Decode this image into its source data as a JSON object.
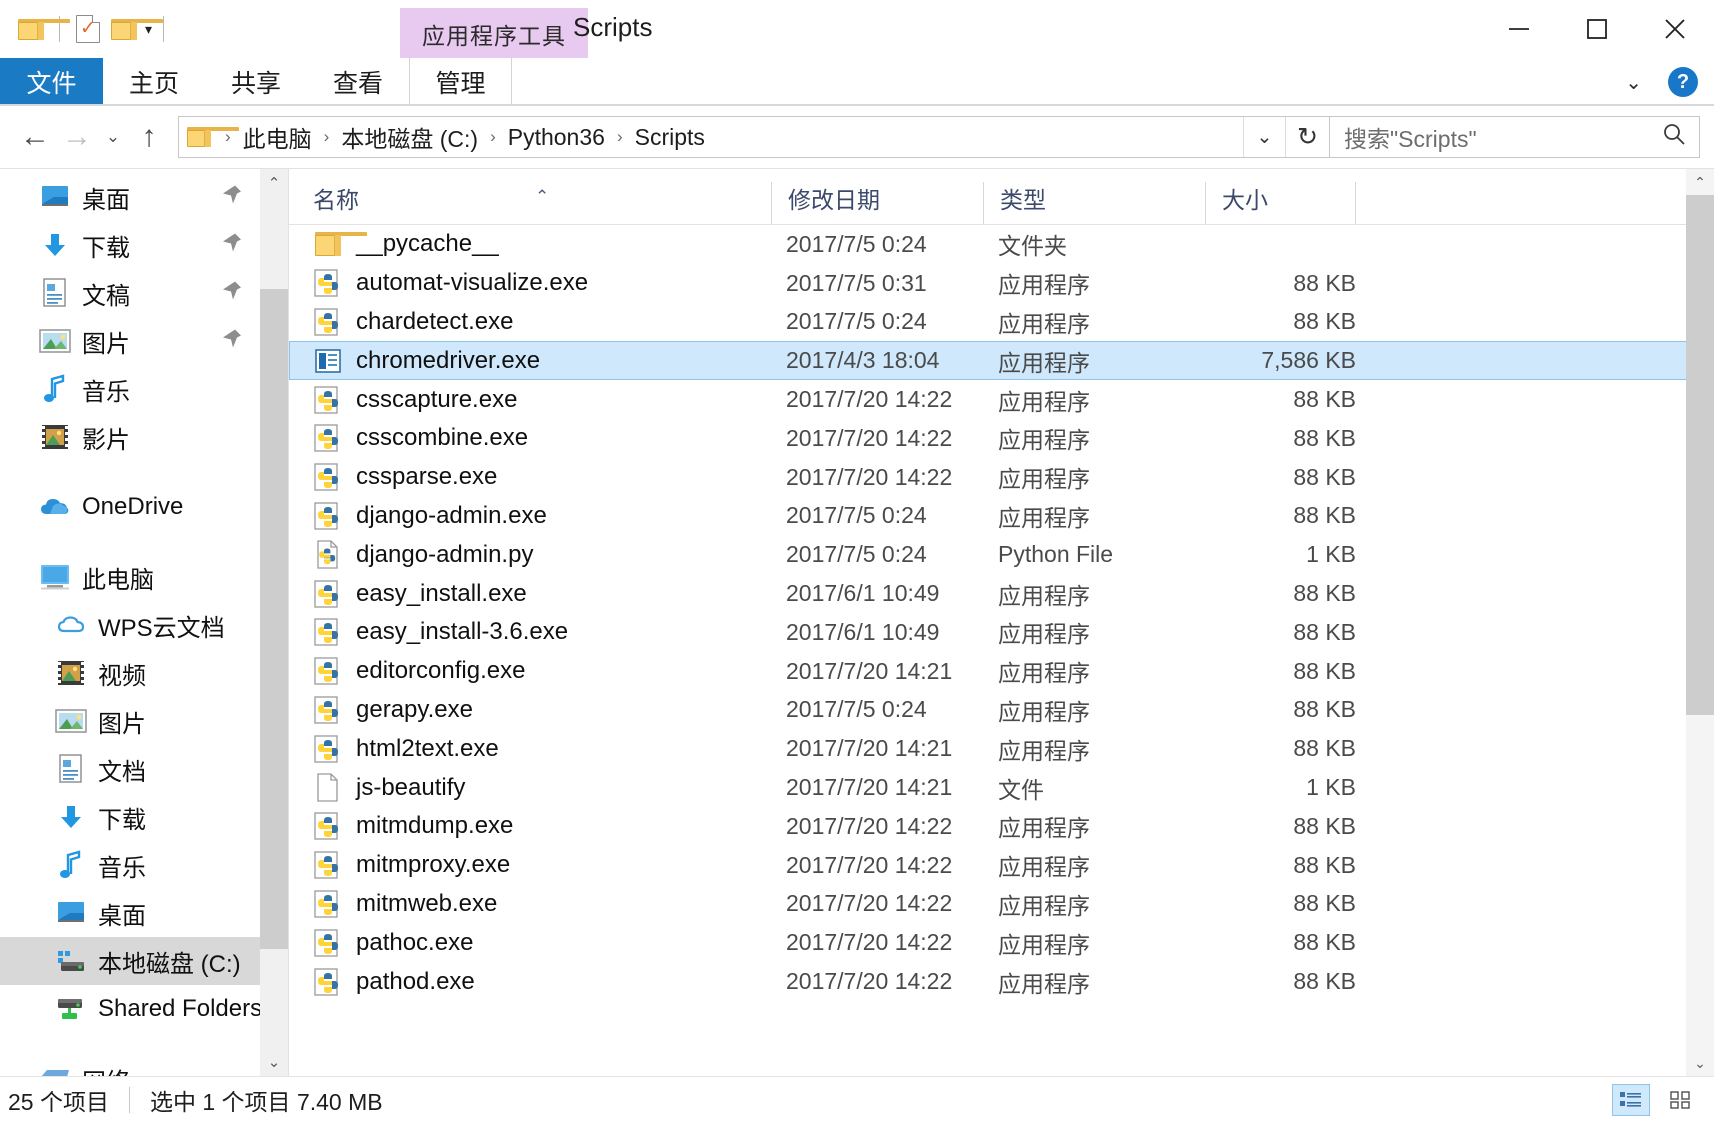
{
  "titlebar": {
    "quick_access": [
      {
        "name": "folder-icon",
        "label": ""
      },
      {
        "name": "checked-document-icon",
        "label": ""
      },
      {
        "name": "folder-new-icon",
        "label": ""
      },
      {
        "name": "chevron-down-icon",
        "label": "▾"
      }
    ],
    "context_tab_label": "应用程序工具",
    "window_title": "Scripts",
    "minimize_label": "—",
    "maximize_label": "□",
    "close_label": "✕"
  },
  "ribbon": {
    "file_tab": "文件",
    "tabs": [
      "主页",
      "共享",
      "查看"
    ],
    "manage_tab": "管理",
    "collapse_label": "⌄",
    "help_label": "?"
  },
  "address": {
    "back_label": "←",
    "forward_label": "→",
    "history_label": "⌄",
    "up_label": "↑",
    "breadcrumbs": [
      "此电脑",
      "本地磁盘 (C:)",
      "Python36",
      "Scripts"
    ],
    "crumb_separator": "›",
    "dropdown_label": "⌄",
    "refresh_label": "↻",
    "search_placeholder": "搜索\"Scripts\"",
    "search_icon": "search-icon"
  },
  "sidebar": {
    "quick_access": [
      {
        "label": "桌面",
        "icon": "desktop-icon",
        "pinned": true
      },
      {
        "label": "下载",
        "icon": "download-icon",
        "pinned": true
      },
      {
        "label": "文稿",
        "icon": "documents-icon",
        "pinned": true
      },
      {
        "label": "图片",
        "icon": "pictures-icon",
        "pinned": true
      },
      {
        "label": "音乐",
        "icon": "music-icon",
        "pinned": false
      },
      {
        "label": "影片",
        "icon": "videos-icon",
        "pinned": false
      }
    ],
    "onedrive": {
      "label": "OneDrive",
      "icon": "onedrive-icon"
    },
    "this_pc": {
      "label": "此电脑",
      "icon": "this-pc-icon"
    },
    "this_pc_children": [
      {
        "label": "WPS云文档",
        "icon": "wps-cloud-icon",
        "selected": false
      },
      {
        "label": "视频",
        "icon": "videos-icon",
        "selected": false
      },
      {
        "label": "图片",
        "icon": "pictures-icon",
        "selected": false
      },
      {
        "label": "文档",
        "icon": "documents-icon",
        "selected": false
      },
      {
        "label": "下载",
        "icon": "download-icon",
        "selected": false
      },
      {
        "label": "音乐",
        "icon": "music-icon",
        "selected": false
      },
      {
        "label": "桌面",
        "icon": "desktop-icon",
        "selected": false
      },
      {
        "label": "本地磁盘 (C:)",
        "icon": "local-disk-icon",
        "selected": true
      },
      {
        "label": "Shared Folders",
        "icon": "network-drive-icon",
        "selected": false
      }
    ],
    "network": {
      "label": "网络",
      "icon": "network-icon"
    }
  },
  "columns": {
    "name": "名称",
    "date": "修改日期",
    "type": "类型",
    "size": "大小",
    "sort_indicator": "⌃"
  },
  "files": [
    {
      "name": "__pycache__",
      "date": "2017/7/5 0:24",
      "type": "文件夹",
      "size": "",
      "icon": "folder-icon",
      "selected": false
    },
    {
      "name": "automat-visualize.exe",
      "date": "2017/7/5 0:31",
      "type": "应用程序",
      "size": "88 KB",
      "icon": "python-exe-icon",
      "selected": false
    },
    {
      "name": "chardetect.exe",
      "date": "2017/7/5 0:24",
      "type": "应用程序",
      "size": "88 KB",
      "icon": "python-exe-icon",
      "selected": false
    },
    {
      "name": "chromedriver.exe",
      "date": "2017/4/3 18:04",
      "type": "应用程序",
      "size": "7,586 KB",
      "icon": "console-exe-icon",
      "selected": true
    },
    {
      "name": "csscapture.exe",
      "date": "2017/7/20 14:22",
      "type": "应用程序",
      "size": "88 KB",
      "icon": "python-exe-icon",
      "selected": false
    },
    {
      "name": "csscombine.exe",
      "date": "2017/7/20 14:22",
      "type": "应用程序",
      "size": "88 KB",
      "icon": "python-exe-icon",
      "selected": false
    },
    {
      "name": "cssparse.exe",
      "date": "2017/7/20 14:22",
      "type": "应用程序",
      "size": "88 KB",
      "icon": "python-exe-icon",
      "selected": false
    },
    {
      "name": "django-admin.exe",
      "date": "2017/7/5 0:24",
      "type": "应用程序",
      "size": "88 KB",
      "icon": "python-exe-icon",
      "selected": false
    },
    {
      "name": "django-admin.py",
      "date": "2017/7/5 0:24",
      "type": "Python File",
      "size": "1 KB",
      "icon": "python-file-icon",
      "selected": false
    },
    {
      "name": "easy_install.exe",
      "date": "2017/6/1 10:49",
      "type": "应用程序",
      "size": "88 KB",
      "icon": "python-exe-icon",
      "selected": false
    },
    {
      "name": "easy_install-3.6.exe",
      "date": "2017/6/1 10:49",
      "type": "应用程序",
      "size": "88 KB",
      "icon": "python-exe-icon",
      "selected": false
    },
    {
      "name": "editorconfig.exe",
      "date": "2017/7/20 14:21",
      "type": "应用程序",
      "size": "88 KB",
      "icon": "python-exe-icon",
      "selected": false
    },
    {
      "name": "gerapy.exe",
      "date": "2017/7/5 0:24",
      "type": "应用程序",
      "size": "88 KB",
      "icon": "python-exe-icon",
      "selected": false
    },
    {
      "name": "html2text.exe",
      "date": "2017/7/20 14:21",
      "type": "应用程序",
      "size": "88 KB",
      "icon": "python-exe-icon",
      "selected": false
    },
    {
      "name": "js-beautify",
      "date": "2017/7/20 14:21",
      "type": "文件",
      "size": "1 KB",
      "icon": "generic-file-icon",
      "selected": false
    },
    {
      "name": "mitmdump.exe",
      "date": "2017/7/20 14:22",
      "type": "应用程序",
      "size": "88 KB",
      "icon": "python-exe-icon",
      "selected": false
    },
    {
      "name": "mitmproxy.exe",
      "date": "2017/7/20 14:22",
      "type": "应用程序",
      "size": "88 KB",
      "icon": "python-exe-icon",
      "selected": false
    },
    {
      "name": "mitmweb.exe",
      "date": "2017/7/20 14:22",
      "type": "应用程序",
      "size": "88 KB",
      "icon": "python-exe-icon",
      "selected": false
    },
    {
      "name": "pathoc.exe",
      "date": "2017/7/20 14:22",
      "type": "应用程序",
      "size": "88 KB",
      "icon": "python-exe-icon",
      "selected": false
    },
    {
      "name": "pathod.exe",
      "date": "2017/7/20 14:22",
      "type": "应用程序",
      "size": "88 KB",
      "icon": "python-exe-icon",
      "selected": false
    }
  ],
  "status": {
    "item_count": "25 个项目",
    "selection": "选中 1 个项目  7.40 MB",
    "view_details_icon": "details-view-icon",
    "view_large_icon": "large-icons-view-icon"
  },
  "colors": {
    "accent": "#1a7ac4",
    "selection_fill": "#cfe8fb",
    "selection_border": "#8fc4e8",
    "context_tab": "#e8c9ef",
    "header_text": "#3b4a6b"
  }
}
